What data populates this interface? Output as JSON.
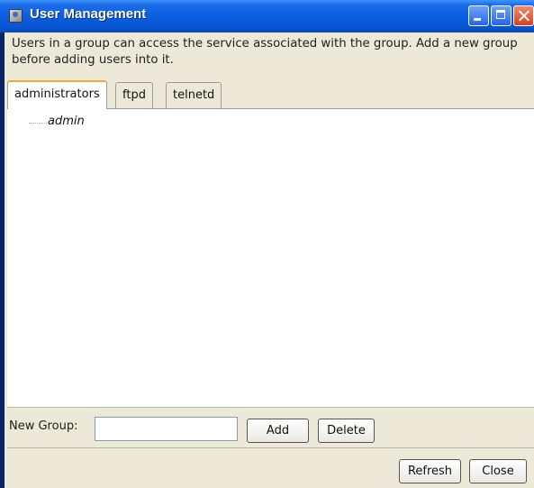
{
  "window": {
    "title": "User Management",
    "controls": [
      "minimize-icon",
      "maximize-icon",
      "close-icon"
    ]
  },
  "info_text": "Users in a group can access the service associated with the group. Add a new group before adding users into it.",
  "tabs": [
    {
      "label": "administrators",
      "active": true
    },
    {
      "label": "ftpd",
      "active": false
    },
    {
      "label": "telnetd",
      "active": false
    }
  ],
  "tree": {
    "items": [
      {
        "label": "admin"
      }
    ]
  },
  "new_group": {
    "label": "New Group:",
    "value": "",
    "add_label": "Add",
    "delete_label": "Delete"
  },
  "footer": {
    "refresh_label": "Refresh",
    "close_label": "Close"
  },
  "colors": {
    "titlebar": "#0a5fe0",
    "window_bg": "#ece9d8",
    "active_tab_accent": "#f2a93b"
  }
}
